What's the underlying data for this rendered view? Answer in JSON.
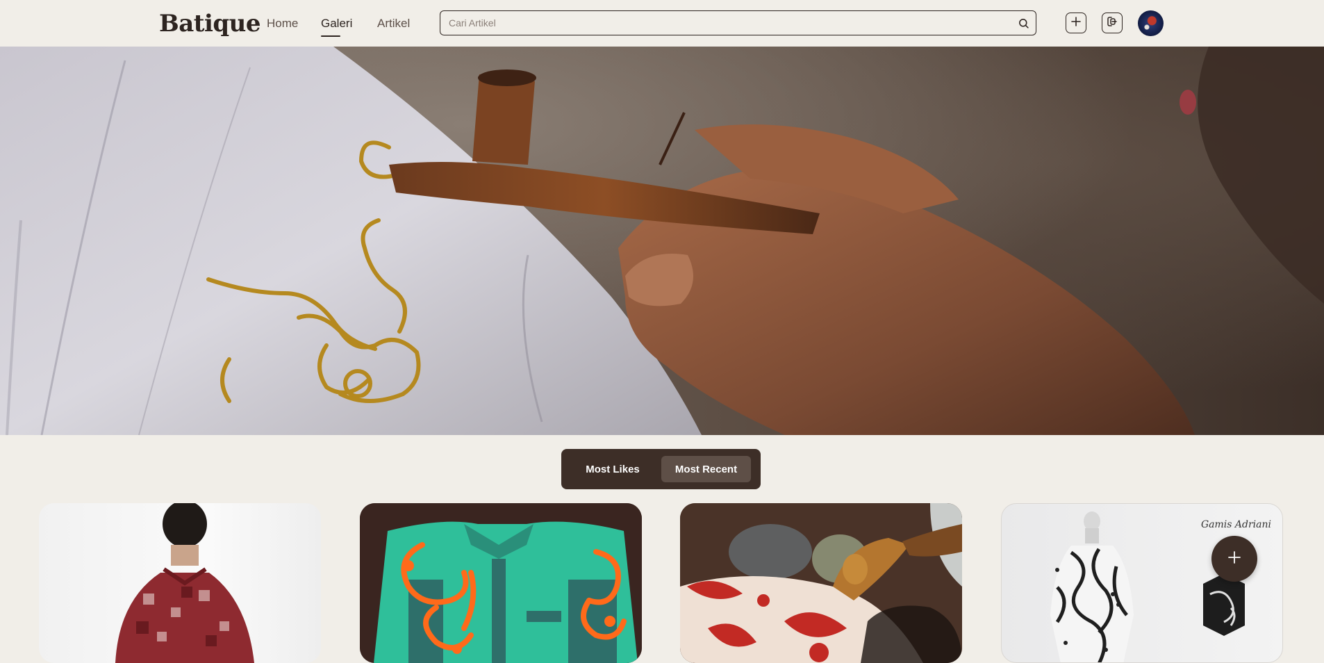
{
  "brand": {
    "logo_text": "Batique"
  },
  "nav": {
    "links": [
      {
        "label": "Home"
      },
      {
        "label": "Galeri",
        "active": true
      },
      {
        "label": "Artikel"
      }
    ]
  },
  "search": {
    "placeholder": "Cari Artikel",
    "value": "",
    "icon": "search-icon"
  },
  "header_actions": {
    "add_icon": "plus-square-icon",
    "share_icon": "logout-square-icon",
    "avatar_icon": "user-avatar"
  },
  "hero": {
    "image": "hand-applying-wax-with-canting-on-white-batik-cloth"
  },
  "sort": {
    "options": [
      {
        "label": "Most Likes",
        "selected": false
      },
      {
        "label": "Most Recent",
        "selected": true
      }
    ]
  },
  "gallery": {
    "cards": [
      {
        "image": "man-wearing-red-patchwork-batik-shirt"
      },
      {
        "image": "teal-and-orange-batik-shirt"
      },
      {
        "image": "canting-tool-on-red-batik-cloth"
      },
      {
        "image": "black-white-batik-gamis-dress",
        "caption": "Gamis Adriani"
      }
    ]
  },
  "fab": {
    "icon": "plus-icon"
  },
  "colors": {
    "background": "#f1eee8",
    "primary_dark": "#3d2e27",
    "toggle_selected": "#5e4f47",
    "text_dark": "#2d2420"
  }
}
